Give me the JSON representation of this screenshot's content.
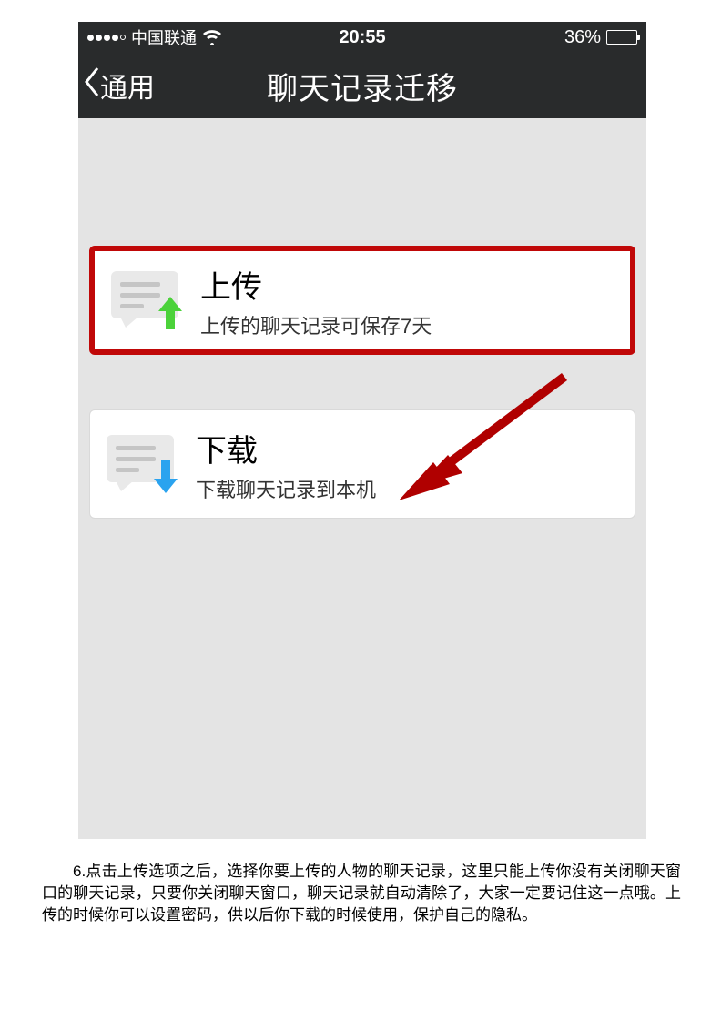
{
  "status": {
    "carrier": "中国联通",
    "time": "20:55",
    "battery_pct": "36%"
  },
  "nav": {
    "back_label": "通用",
    "title": "聊天记录迁移"
  },
  "options": {
    "upload": {
      "title": "上传",
      "subtitle": "上传的聊天记录可保存7天"
    },
    "download": {
      "title": "下载",
      "subtitle": "下载聊天记录到本机"
    }
  },
  "instruction": "6.点击上传选项之后，选择你要上传的人物的聊天记录，这里只能上传你没有关闭聊天窗口的聊天记录，只要你关闭聊天窗口，聊天记录就自动清除了，大家一定要记住这一点哦。上传的时候你可以设置密码，供以后你下载的时候使用，保护自己的隐私。"
}
